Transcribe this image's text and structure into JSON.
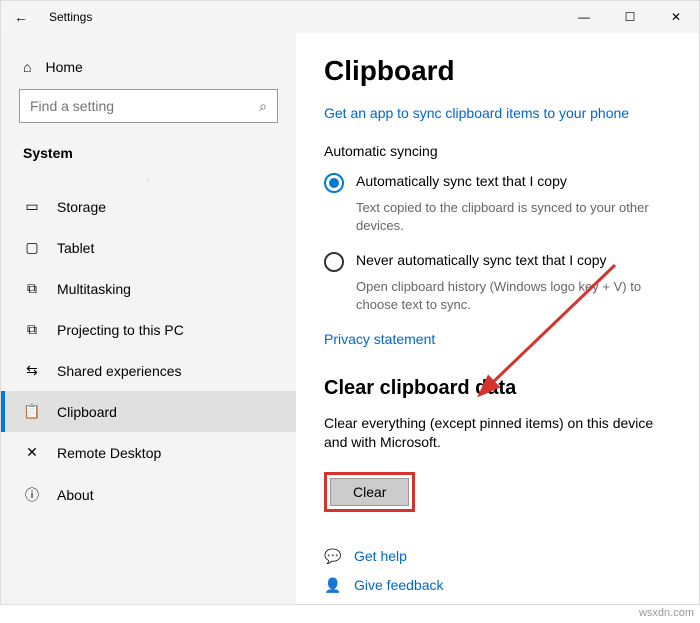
{
  "titlebar": {
    "back": "←",
    "title": "Settings",
    "min": "—",
    "max": "☐",
    "close": "✕"
  },
  "sidebar": {
    "home_label": "Home",
    "search_placeholder": "Find a setting",
    "category": "System",
    "items": [
      {
        "icon": "storage",
        "label": "Storage"
      },
      {
        "icon": "tablet",
        "label": "Tablet"
      },
      {
        "icon": "multitask",
        "label": "Multitasking"
      },
      {
        "icon": "project",
        "label": "Projecting to this PC"
      },
      {
        "icon": "shared",
        "label": "Shared experiences"
      },
      {
        "icon": "clipboard",
        "label": "Clipboard"
      },
      {
        "icon": "remote",
        "label": "Remote Desktop"
      },
      {
        "icon": "about",
        "label": "About"
      }
    ],
    "selected_index": 5
  },
  "content": {
    "heading": "Clipboard",
    "sync_link": "Get an app to sync clipboard items to your phone",
    "auto_label": "Automatic syncing",
    "radio1_label": "Automatically sync text that I copy",
    "radio1_desc": "Text copied to the clipboard is synced to your other devices.",
    "radio2_label": "Never automatically sync text that I copy",
    "radio2_desc": "Open clipboard history (Windows logo key + V) to choose text to sync.",
    "privacy_link": "Privacy statement",
    "clear_heading": "Clear clipboard data",
    "clear_desc": "Clear everything (except pinned items) on this device and with Microsoft.",
    "clear_btn": "Clear",
    "help_label": "Get help",
    "feedback_label": "Give feedback"
  },
  "watermark": "wsxdn.com"
}
